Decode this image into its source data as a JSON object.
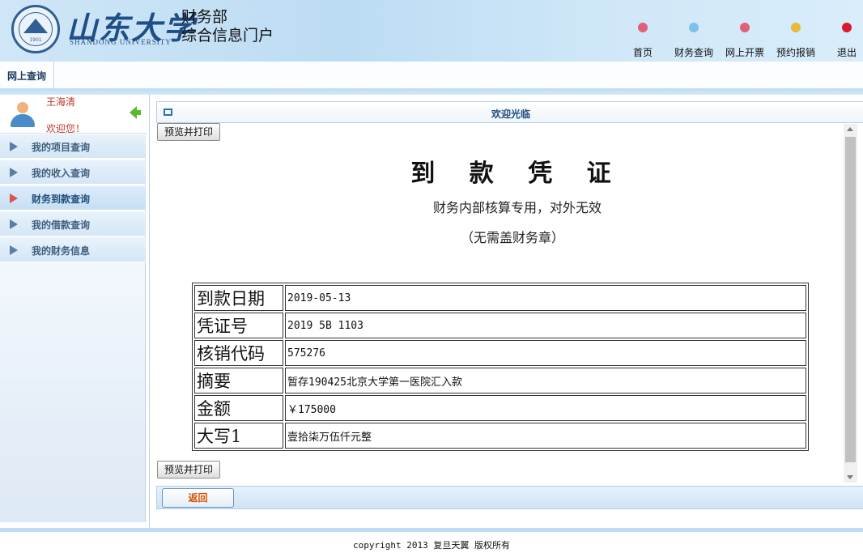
{
  "header": {
    "logo_cn": "山东大学",
    "logo_en": "SHANDONG UNIVERSITY",
    "seal_year": "1901",
    "portal_line1": "财务部",
    "portal_line2": "综合信息门户",
    "nav": [
      {
        "label": "首页",
        "color": "#e0607a"
      },
      {
        "label": "财务查询",
        "color": "#7ec0e8"
      },
      {
        "label": "网上开票",
        "color": "#e0607a"
      },
      {
        "label": "预约报销",
        "color": "#e8b93a"
      },
      {
        "label": "退出",
        "color": "#d8182e"
      }
    ]
  },
  "topbar": {
    "tab": "网上查询"
  },
  "sidebar": {
    "username": "王海清",
    "welcome": "欢迎您！",
    "items": [
      {
        "label": "我的项目查询"
      },
      {
        "label": "我的收入查询"
      },
      {
        "label": "财务到款查询"
      },
      {
        "label": "我的借款查询"
      },
      {
        "label": "我的财务信息"
      }
    ]
  },
  "panel": {
    "title": "欢迎光临",
    "print_button": "预览并打印",
    "return_button": "返回"
  },
  "voucher": {
    "title": "到 款 凭 证",
    "subtitle": "财务内部核算专用，对外无效",
    "note": "（无需盖财务章）",
    "rows": [
      {
        "label": "到款日期",
        "value": "2019-05-13"
      },
      {
        "label": "凭证号",
        "value": "2019 5B 1103"
      },
      {
        "label": "核销代码",
        "value": "575276"
      },
      {
        "label": "摘要",
        "value": "暂存190425北京大学第一医院汇入款"
      },
      {
        "label": "金额",
        "value": "￥175000"
      },
      {
        "label": "大写1",
        "value": "壹拾柒万伍仟元整"
      }
    ]
  },
  "footer": {
    "copyright": "copyright 2013 复旦天翼 版权所有"
  }
}
